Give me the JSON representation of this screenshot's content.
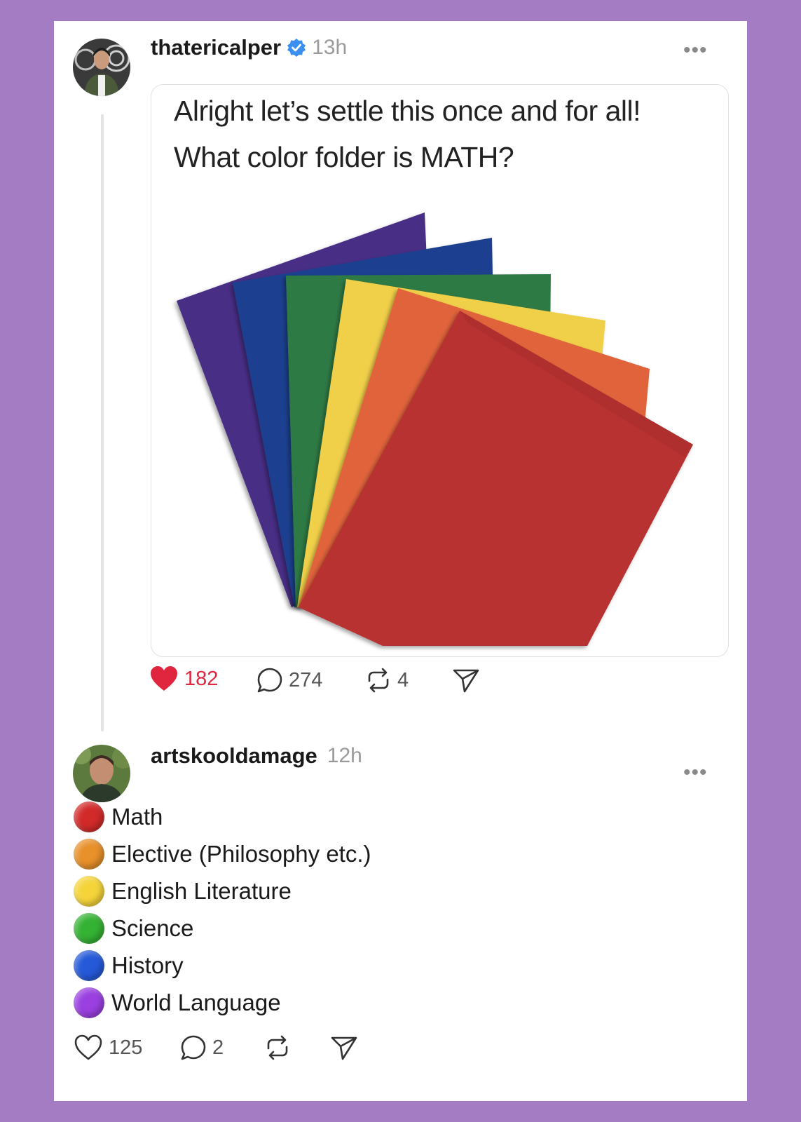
{
  "post": {
    "username": "thatericalper",
    "time": "13h",
    "more_label": "•••",
    "meme_line1": "Alright let’s settle this once and for all!",
    "meme_line2": "What color folder is MATH?",
    "likes": "182",
    "comments": "274",
    "reposts": "4",
    "folder_colors": [
      "#4a2f86",
      "#1f3f8f",
      "#2e7a45",
      "#f0cf4a",
      "#e0643a",
      "#b83333"
    ]
  },
  "reply": {
    "username": "artskooldamage",
    "time": "12h",
    "more_label": "•••",
    "items": [
      {
        "label": "Math",
        "color": "#d22a2a"
      },
      {
        "label": "Elective (Philosophy etc.)",
        "color": "#e8902a"
      },
      {
        "label": "English Literature",
        "color": "#f5d43a"
      },
      {
        "label": "Science",
        "color": "#34b233"
      },
      {
        "label": "History",
        "color": "#2559d8"
      },
      {
        "label": "World Language",
        "color": "#9a3fe0"
      }
    ],
    "likes": "125",
    "comments": "2"
  },
  "colors": {
    "background": "#a47cc3",
    "verified": "#3b8ff0",
    "liked": "#e0263e"
  }
}
